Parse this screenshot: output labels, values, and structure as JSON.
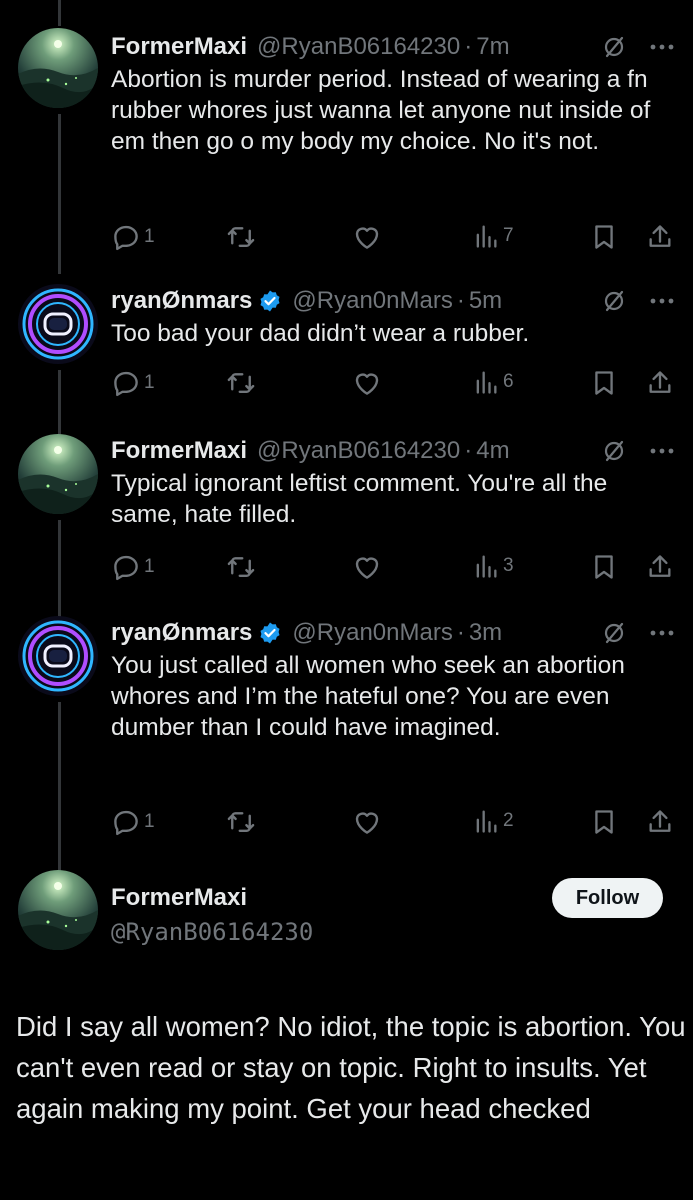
{
  "colors": {
    "background": "#000000",
    "text": "#e7e9ea",
    "muted": "#71767b",
    "verified": "#1d9bf0",
    "thread_line": "#333639",
    "follow_bg": "#eff3f4"
  },
  "replies": [
    {
      "name": "FormerMaxi",
      "handle": "@RyanB06164230",
      "time": "7m",
      "verified": false,
      "text": "Abortion is murder period. Instead of wearing a fn rubber whores just wanna let anyone nut inside of em then go o my body my choice. No it's not.",
      "replies": "1",
      "views": "7"
    },
    {
      "name": "ryanØnmars",
      "handle": "@Ryan0nMars",
      "time": "5m",
      "verified": true,
      "text": "Too bad your dad didn’t wear a rubber.",
      "replies": "1",
      "views": "6"
    },
    {
      "name": "FormerMaxi",
      "handle": "@RyanB06164230",
      "time": "4m",
      "verified": false,
      "text": "Typical ignorant leftist comment. You're all the same, hate filled.",
      "replies": "1",
      "views": "3"
    },
    {
      "name": "ryanØnmars",
      "handle": "@Ryan0nMars",
      "time": "3m",
      "verified": true,
      "text": "You just called all women who seek an abortion whores and I’m the hateful one? You are even dumber than I could have imagined.",
      "replies": "1",
      "views": "2"
    }
  ],
  "main": {
    "name": "FormerMaxi",
    "handle": "@RyanB06164230",
    "follow_label": "Follow",
    "text": "Did I say all women? No idiot, the topic is abortion. You can't even read or stay on topic. Right to insults. Yet again making my point. Get your head checked"
  },
  "icons": {
    "reply": "reply-bubble-icon",
    "retweet": "retweet-icon",
    "like": "heart-icon",
    "views": "views-bar-icon",
    "bookmark": "bookmark-icon",
    "share": "share-upload-icon",
    "grok": "grok-slash-circle-icon",
    "more": "more-dots-icon",
    "verified": "verified-badge-icon"
  }
}
